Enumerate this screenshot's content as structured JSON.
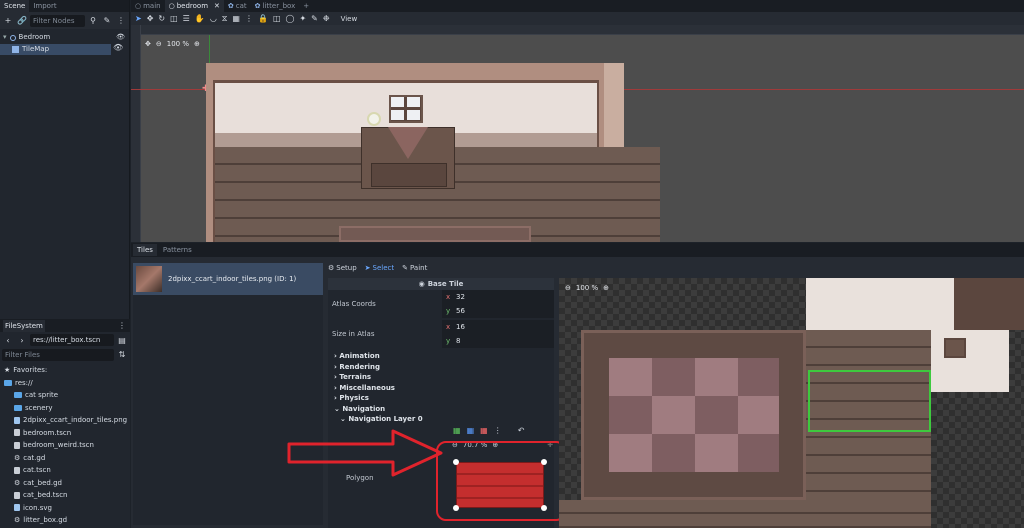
{
  "scene_dock": {
    "tabs": [
      "Scene",
      "Import"
    ],
    "filter_placeholder": "Filter Nodes",
    "tree": [
      {
        "label": "Bedroom"
      },
      {
        "label": "TileMap"
      }
    ]
  },
  "filesystem": {
    "title": "FileSystem",
    "path": "res://litter_box.tscn",
    "filter_placeholder": "Filter Files",
    "items": [
      {
        "label": "Favorites:",
        "kind": "star",
        "indent": 0
      },
      {
        "label": "res://",
        "kind": "folder",
        "indent": 0
      },
      {
        "label": "cat sprite",
        "kind": "folder",
        "indent": 1
      },
      {
        "label": "scenery",
        "kind": "folder",
        "indent": 1
      },
      {
        "label": "2dpixx_ccart_indoor_tiles.png",
        "kind": "image",
        "indent": 1
      },
      {
        "label": "bedroom.tscn",
        "kind": "scene",
        "indent": 1
      },
      {
        "label": "bedroom_weird.tscn",
        "kind": "scene",
        "indent": 1
      },
      {
        "label": "cat.gd",
        "kind": "script",
        "indent": 1
      },
      {
        "label": "cat.tscn",
        "kind": "scene",
        "indent": 1
      },
      {
        "label": "cat_bed.gd",
        "kind": "script",
        "indent": 1
      },
      {
        "label": "cat_bed.tscn",
        "kind": "scene",
        "indent": 1
      },
      {
        "label": "icon.svg",
        "kind": "image",
        "indent": 1
      },
      {
        "label": "litter_box.gd",
        "kind": "script",
        "indent": 1
      }
    ]
  },
  "editor_tabs": [
    {
      "label": "main"
    },
    {
      "label": "bedroom"
    },
    {
      "label": "cat"
    },
    {
      "label": "litter_box"
    }
  ],
  "toolbar": {
    "view_label": "View"
  },
  "viewport": {
    "zoom": "100 %"
  },
  "bottom_tabs": [
    "Tiles",
    "Patterns"
  ],
  "tileset": {
    "source_label": "2dpixx_ccart_indoor_tiles.png (ID: 1)",
    "modes": [
      "Setup",
      "Select",
      "Paint"
    ],
    "base_tile": "Base Tile",
    "atlas_coords": {
      "label": "Atlas Coords",
      "x": "32",
      "y": "56"
    },
    "size_in_atlas": {
      "label": "Size in Atlas",
      "x": "16",
      "y": "8"
    },
    "sections": [
      "Animation",
      "Rendering",
      "Terrains",
      "Miscellaneous",
      "Physics",
      "Navigation"
    ],
    "nav_layer": "Navigation Layer 0",
    "poly_zoom": "70.7 %",
    "polygon_label": "Polygon",
    "atlas_zoom": "100 %"
  },
  "colors": {
    "accent": "#478cbf",
    "annotation": "#e0232c",
    "selection": "#3ec93e",
    "tile_red": "#c42e2e"
  }
}
